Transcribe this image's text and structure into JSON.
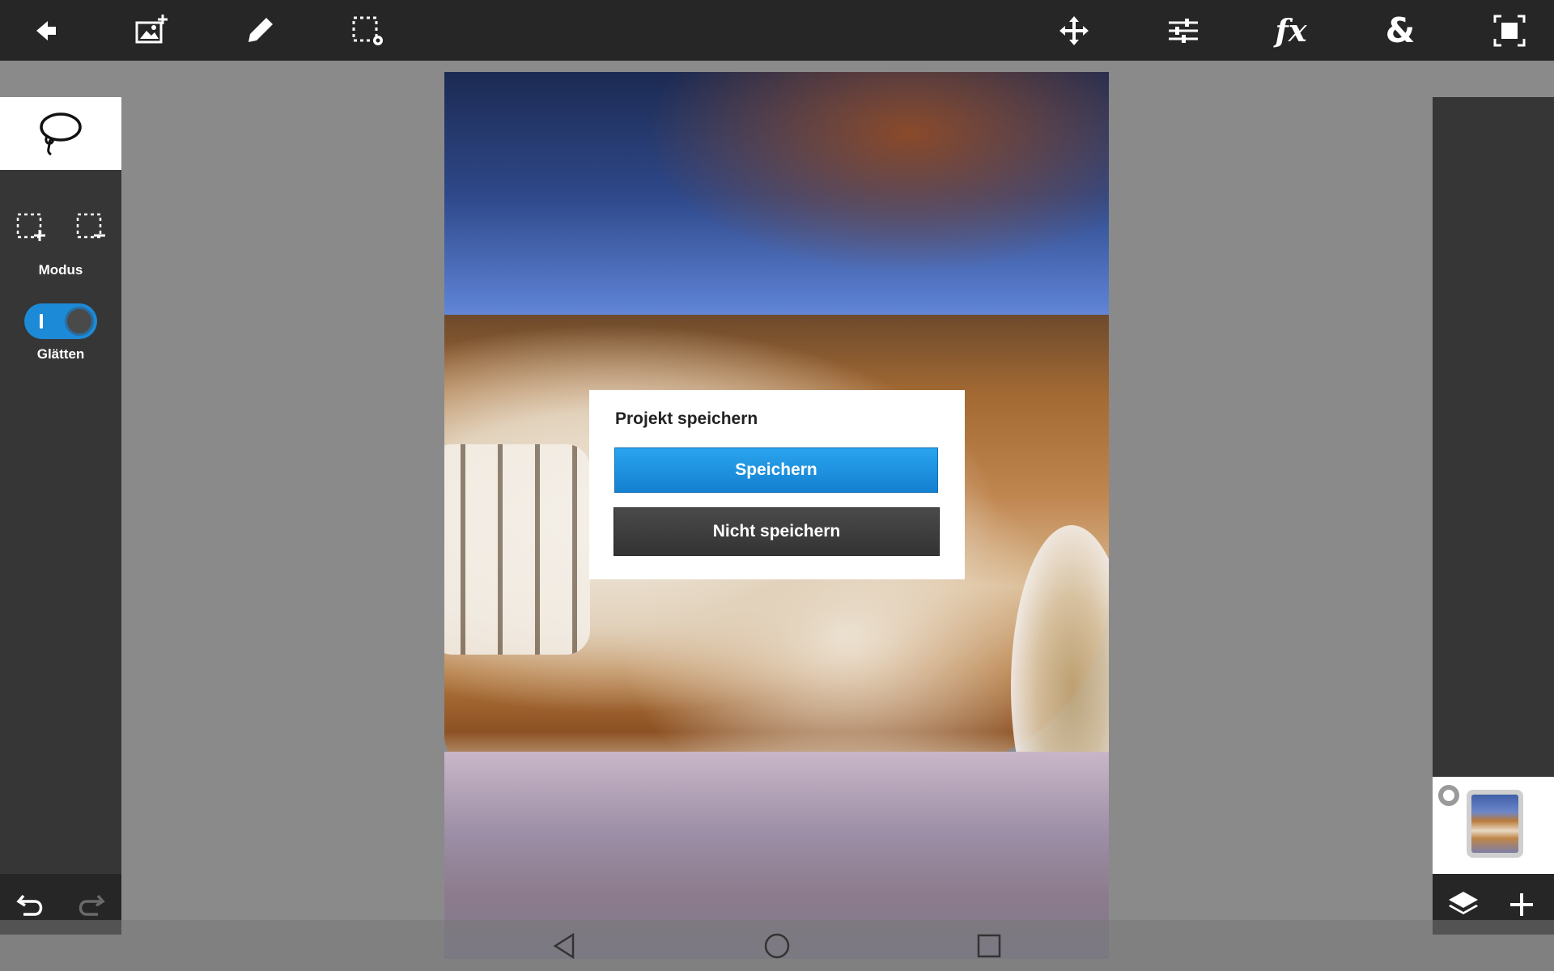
{
  "toolbar": {
    "icons": [
      "back-arrow-icon",
      "add-image-icon",
      "brush-icon",
      "selection-settings-icon",
      "move-icon",
      "adjustments-icon",
      "fx-icon",
      "blend-icon",
      "crop-icon"
    ],
    "fx_label": "fx",
    "blend_label": "&"
  },
  "left_panel": {
    "tool": "lasso-icon",
    "mode_label": "Modus",
    "smooth_label": "Glätten",
    "smooth_enabled": true
  },
  "dialog": {
    "title": "Projekt speichern",
    "save_label": "Speichern",
    "dont_save_label": "Nicht speichern",
    "save_color": "#1a8fe0"
  },
  "navbar": {
    "icons": [
      "back-triangle-icon",
      "home-circle-icon",
      "recents-square-icon"
    ]
  },
  "colors": {
    "toolbar": "#262626",
    "panel": "#363636",
    "workspace": "#8a8a8a",
    "accent": "#1d8ad8"
  }
}
